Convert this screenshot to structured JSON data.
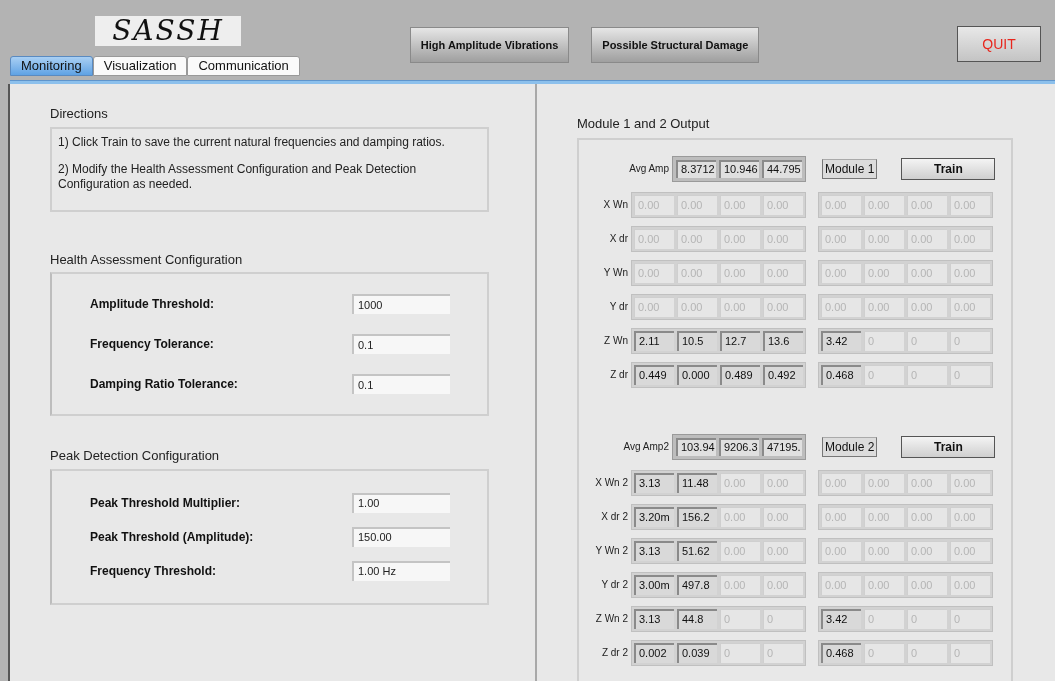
{
  "logo": "SASSH",
  "tabs": [
    {
      "label": "Monitoring",
      "selected": true
    },
    {
      "label": "Visualization",
      "selected": false
    },
    {
      "label": "Communication",
      "selected": false
    }
  ],
  "indicators": [
    "High Amplitude Vibrations",
    "Possible Structural Damage"
  ],
  "quit_button": "QUIT",
  "directions": {
    "title": "Directions",
    "steps": [
      "1) Click Train to save the current natural frequencies and damping ratios.",
      "2) Modify the Health Assessment Configuration and Peak Detection Configuration as needed."
    ]
  },
  "health_assessment": {
    "title": "Health Assessment Configuration",
    "fields": [
      {
        "label": "Amplitude Threshold:",
        "value": "1000"
      },
      {
        "label": "Frequency Tolerance:",
        "value": "0.1"
      },
      {
        "label": "Damping Ratio Tolerance:",
        "value": "0.1"
      }
    ]
  },
  "peak_detection": {
    "title": "Peak Detection Configuration",
    "fields": [
      {
        "label": "Peak Threshold Multiplier:",
        "value": "1.00"
      },
      {
        "label": "Peak Threshold (Amplitude):",
        "value": "150.00"
      },
      {
        "label": "Frequency Threshold:",
        "value": "1.00 Hz"
      }
    ]
  },
  "output": {
    "title": "Module 1 and 2 Output",
    "modules": [
      {
        "avg_label": "Avg Amp",
        "avg_values": [
          "8.3712",
          "10.946",
          "44.795"
        ],
        "module_label": "Module 1",
        "train_button": "Train",
        "rows": [
          {
            "label": "X Wn",
            "cells": [
              {
                "value": "0.00",
                "disabled": true
              },
              {
                "value": "0.00",
                "disabled": true
              },
              {
                "value": "0.00",
                "disabled": true
              },
              {
                "value": "0.00",
                "disabled": true
              }
            ],
            "module_cells": [
              {
                "value": "0.00",
                "disabled": true
              },
              {
                "value": "0.00",
                "disabled": true
              },
              {
                "value": "0.00",
                "disabled": true
              },
              {
                "value": "0.00",
                "disabled": true
              }
            ]
          },
          {
            "label": "X dr",
            "cells": [
              {
                "value": "0.00",
                "disabled": true
              },
              {
                "value": "0.00",
                "disabled": true
              },
              {
                "value": "0.00",
                "disabled": true
              },
              {
                "value": "0.00",
                "disabled": true
              }
            ],
            "module_cells": [
              {
                "value": "0.00",
                "disabled": true
              },
              {
                "value": "0.00",
                "disabled": true
              },
              {
                "value": "0.00",
                "disabled": true
              },
              {
                "value": "0.00",
                "disabled": true
              }
            ]
          },
          {
            "label": "Y Wn",
            "cells": [
              {
                "value": "0.00",
                "disabled": true
              },
              {
                "value": "0.00",
                "disabled": true
              },
              {
                "value": "0.00",
                "disabled": true
              },
              {
                "value": "0.00",
                "disabled": true
              }
            ],
            "module_cells": [
              {
                "value": "0.00",
                "disabled": true
              },
              {
                "value": "0.00",
                "disabled": true
              },
              {
                "value": "0.00",
                "disabled": true
              },
              {
                "value": "0.00",
                "disabled": true
              }
            ]
          },
          {
            "label": "Y dr",
            "cells": [
              {
                "value": "0.00",
                "disabled": true
              },
              {
                "value": "0.00",
                "disabled": true
              },
              {
                "value": "0.00",
                "disabled": true
              },
              {
                "value": "0.00",
                "disabled": true
              }
            ],
            "module_cells": [
              {
                "value": "0.00",
                "disabled": true
              },
              {
                "value": "0.00",
                "disabled": true
              },
              {
                "value": "0.00",
                "disabled": true
              },
              {
                "value": "0.00",
                "disabled": true
              }
            ]
          },
          {
            "label": "Z Wn",
            "cells": [
              {
                "value": "2.11",
                "disabled": false
              },
              {
                "value": "10.5",
                "disabled": false
              },
              {
                "value": "12.7",
                "disabled": false
              },
              {
                "value": "13.6",
                "disabled": false
              }
            ],
            "module_cells": [
              {
                "value": "3.42",
                "disabled": false
              },
              {
                "value": "0",
                "disabled": true
              },
              {
                "value": "0",
                "disabled": true
              },
              {
                "value": "0",
                "disabled": true
              }
            ]
          },
          {
            "label": "Z dr",
            "cells": [
              {
                "value": "0.449",
                "disabled": false
              },
              {
                "value": "0.000",
                "disabled": false
              },
              {
                "value": "0.489",
                "disabled": false
              },
              {
                "value": "0.492",
                "disabled": false
              }
            ],
            "module_cells": [
              {
                "value": "0.468",
                "disabled": false
              },
              {
                "value": "0",
                "disabled": true
              },
              {
                "value": "0",
                "disabled": true
              },
              {
                "value": "0",
                "disabled": true
              }
            ]
          }
        ]
      },
      {
        "avg_label": "Avg Amp2",
        "avg_values": [
          "103.94",
          "9206.3",
          "47195."
        ],
        "module_label": "Module 2",
        "train_button": "Train",
        "rows": [
          {
            "label": "X Wn 2",
            "cells": [
              {
                "value": "3.13",
                "disabled": false
              },
              {
                "value": "11.48",
                "disabled": false
              },
              {
                "value": "0.00",
                "disabled": true
              },
              {
                "value": "0.00",
                "disabled": true
              }
            ],
            "module_cells": [
              {
                "value": "0.00",
                "disabled": true
              },
              {
                "value": "0.00",
                "disabled": true
              },
              {
                "value": "0.00",
                "disabled": true
              },
              {
                "value": "0.00",
                "disabled": true
              }
            ]
          },
          {
            "label": "X dr 2",
            "cells": [
              {
                "value": "3.20m",
                "disabled": false
              },
              {
                "value": "156.2",
                "disabled": false
              },
              {
                "value": "0.00",
                "disabled": true
              },
              {
                "value": "0.00",
                "disabled": true
              }
            ],
            "module_cells": [
              {
                "value": "0.00",
                "disabled": true
              },
              {
                "value": "0.00",
                "disabled": true
              },
              {
                "value": "0.00",
                "disabled": true
              },
              {
                "value": "0.00",
                "disabled": true
              }
            ]
          },
          {
            "label": "Y Wn 2",
            "cells": [
              {
                "value": "3.13",
                "disabled": false
              },
              {
                "value": "51.62",
                "disabled": false
              },
              {
                "value": "0.00",
                "disabled": true
              },
              {
                "value": "0.00",
                "disabled": true
              }
            ],
            "module_cells": [
              {
                "value": "0.00",
                "disabled": true
              },
              {
                "value": "0.00",
                "disabled": true
              },
              {
                "value": "0.00",
                "disabled": true
              },
              {
                "value": "0.00",
                "disabled": true
              }
            ]
          },
          {
            "label": "Y dr 2",
            "cells": [
              {
                "value": "3.00m",
                "disabled": false
              },
              {
                "value": "497.8",
                "disabled": false
              },
              {
                "value": "0.00",
                "disabled": true
              },
              {
                "value": "0.00",
                "disabled": true
              }
            ],
            "module_cells": [
              {
                "value": "0.00",
                "disabled": true
              },
              {
                "value": "0.00",
                "disabled": true
              },
              {
                "value": "0.00",
                "disabled": true
              },
              {
                "value": "0.00",
                "disabled": true
              }
            ]
          },
          {
            "label": "Z Wn 2",
            "cells": [
              {
                "value": "3.13",
                "disabled": false
              },
              {
                "value": "44.8",
                "disabled": false
              },
              {
                "value": "0",
                "disabled": true
              },
              {
                "value": "0",
                "disabled": true
              }
            ],
            "module_cells": [
              {
                "value": "3.42",
                "disabled": false
              },
              {
                "value": "0",
                "disabled": true
              },
              {
                "value": "0",
                "disabled": true
              },
              {
                "value": "0",
                "disabled": true
              }
            ]
          },
          {
            "label": "Z dr 2",
            "cells": [
              {
                "value": "0.002",
                "disabled": false
              },
              {
                "value": "0.039",
                "disabled": false
              },
              {
                "value": "0",
                "disabled": true
              },
              {
                "value": "0",
                "disabled": true
              }
            ],
            "module_cells": [
              {
                "value": "0.468",
                "disabled": false
              },
              {
                "value": "0",
                "disabled": true
              },
              {
                "value": "0",
                "disabled": true
              },
              {
                "value": "0",
                "disabled": true
              }
            ]
          }
        ]
      }
    ]
  }
}
